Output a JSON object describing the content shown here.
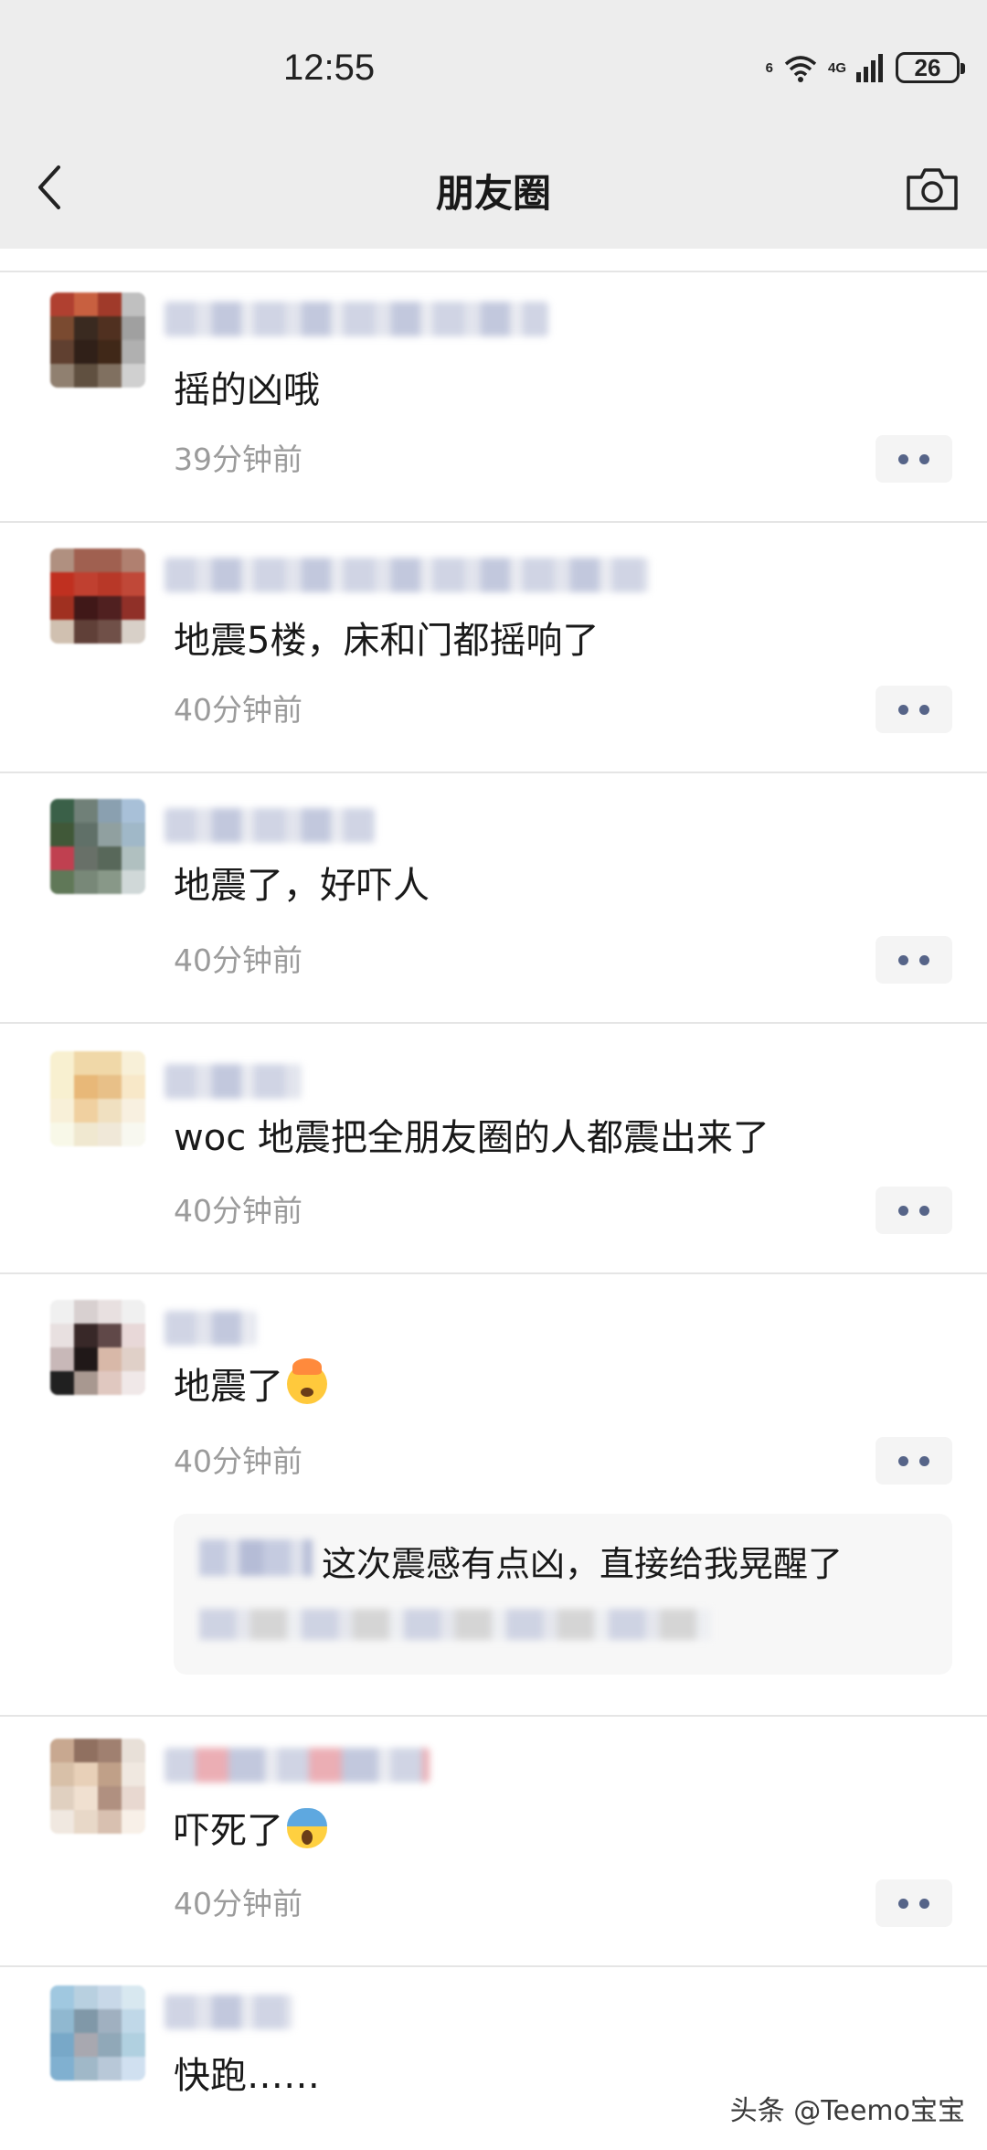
{
  "status_bar": {
    "time": "12:55",
    "network_label": "4G",
    "wifi_label": "6",
    "battery": "26"
  },
  "nav": {
    "title": "朋友圈",
    "back_icon": "chevron-left-icon",
    "camera_icon": "camera-icon"
  },
  "comments": [
    {
      "text": "摇的凶哦",
      "time": "39分钟前"
    },
    {
      "text": "地震5楼，床和门都摇响了",
      "time": "40分钟前"
    },
    {
      "text": "地震了，好吓人",
      "time": "40分钟前"
    },
    {
      "text": "woc 地震把全朋友圈的人都震出来了",
      "time": "40分钟前"
    },
    {
      "text": "地震了",
      "time": "40分钟前",
      "emoji": "mind-blown-emoji",
      "reply": {
        "text": "这次震感有点凶，直接给我晃醒了"
      }
    },
    {
      "text": "吓死了",
      "time": "40分钟前",
      "emoji": "screaming-face-emoji"
    },
    {
      "text": "快跑……"
    }
  ],
  "watermark": "头条 @Teemo宝宝",
  "colors": {
    "chrome_bg": "#ededed",
    "time_gray": "#9b9b9b",
    "more_dots": "#566488",
    "separator": "#e5e5e5"
  }
}
